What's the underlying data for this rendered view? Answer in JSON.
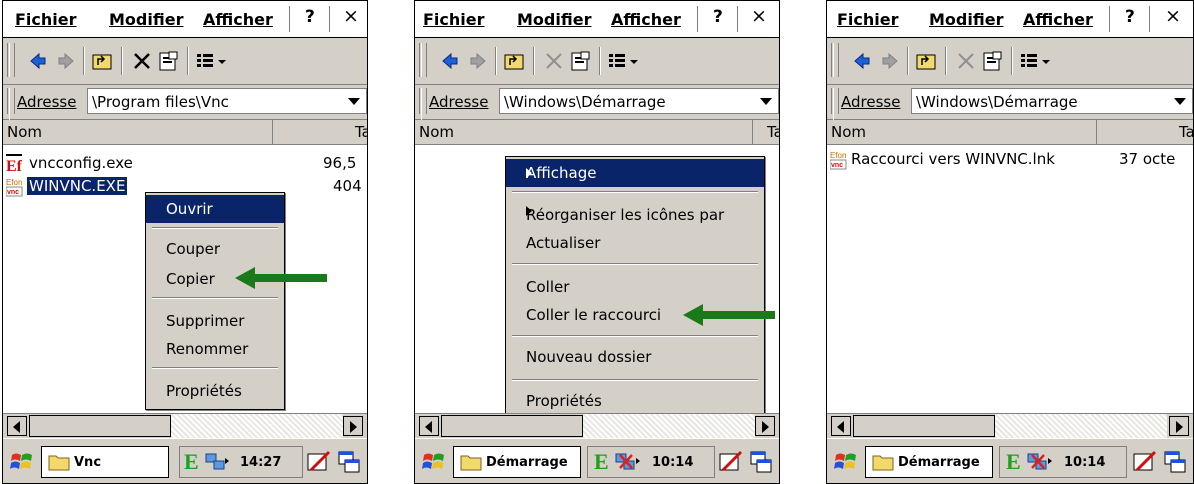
{
  "menubar": {
    "fichier": "Fichier",
    "modifier": "Modifier",
    "afficher": "Afficher",
    "help": "?",
    "close": "×"
  },
  "address_label": "Adresse",
  "columns": {
    "name": "Nom",
    "size": "Ta"
  },
  "panels": [
    {
      "address": "\\Program files\\Vnc",
      "files": [
        {
          "name": "vncconfig.exe",
          "size": "96,5",
          "icon": "ef-exe-icon",
          "selected": false
        },
        {
          "name": "WINVNC.EXE",
          "size": "404",
          "icon": "efon-vnc-icon",
          "selected": true
        }
      ],
      "context_menu": [
        "Ouvrir",
        "Couper",
        "Copier",
        "Supprimer",
        "Renommer",
        "Propriétés"
      ],
      "task_label": "Vnc",
      "clock": "14:27"
    },
    {
      "address": "\\Windows\\Démarrage",
      "files": [],
      "context_menu": [
        "Affichage",
        "Réorganiser les icônes par",
        "Actualiser",
        "Coller",
        "Coller le raccourci",
        "Nouveau dossier",
        "Propriétés"
      ],
      "task_label": "Démarrage",
      "clock": "10:14"
    },
    {
      "address": "\\Windows\\Démarrage",
      "files": [
        {
          "name": "Raccourci vers WINVNC.lnk",
          "size": "37 octe",
          "icon": "efon-vnc-icon",
          "selected": false
        }
      ],
      "task_label": "Démarrage",
      "clock": "10:14"
    }
  ],
  "colors": {
    "highlight": "#0a246a",
    "chrome": "#d4d0c8",
    "arrow": "#1a7a1a"
  }
}
